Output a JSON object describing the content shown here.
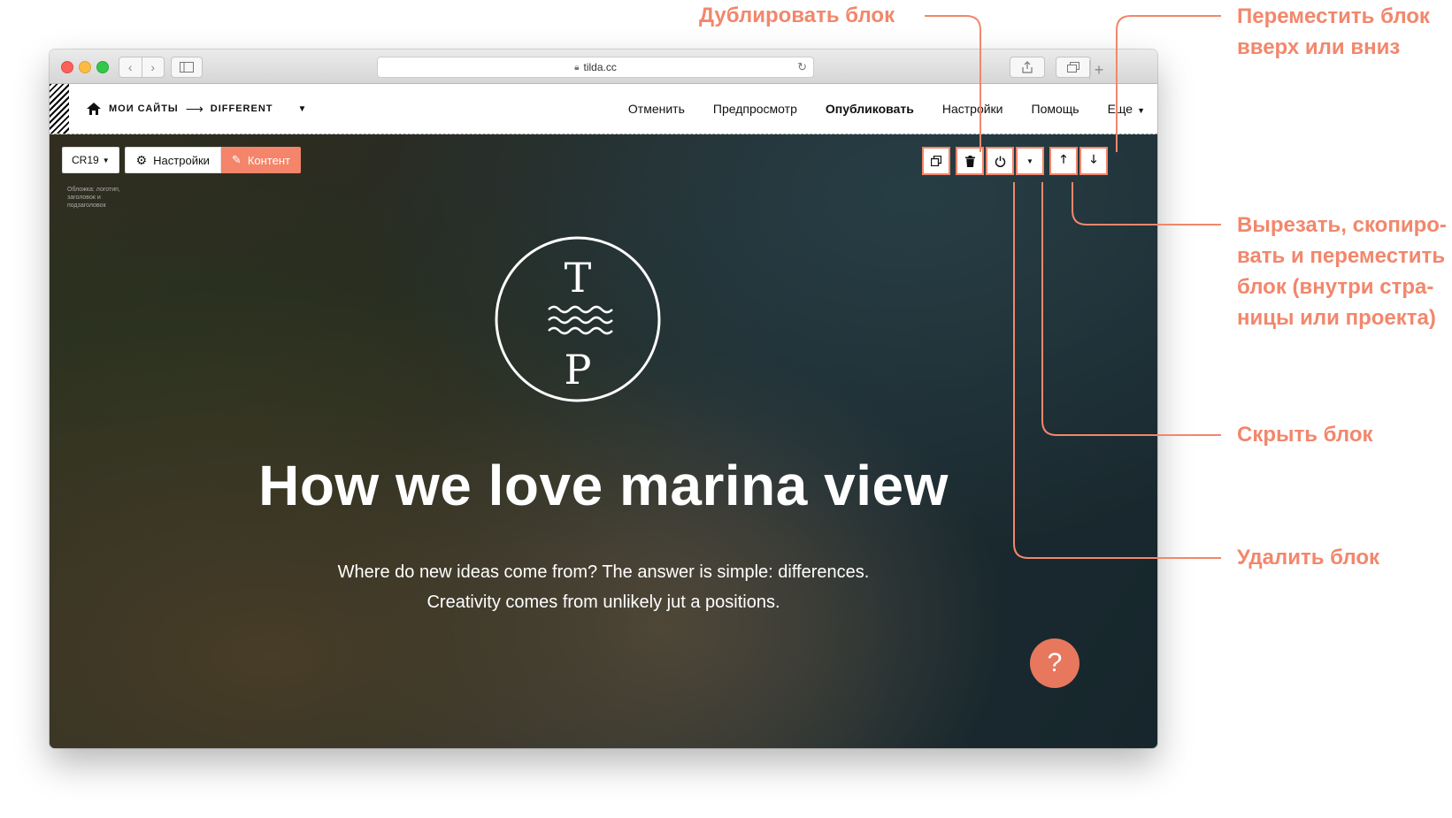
{
  "browser": {
    "url": "tilda.cc",
    "nav_back": "‹",
    "nav_forward": "›"
  },
  "topbar": {
    "breadcrumb_sites": "МОИ САЙТЫ",
    "breadcrumb_arrow": "⟶",
    "breadcrumb_project": "DIFFERENT",
    "menu": [
      "Отменить",
      "Предпросмотр",
      "Опубликовать",
      "Настройки",
      "Помощь",
      "Еще"
    ]
  },
  "block": {
    "code_label": "CR19",
    "settings_label": "Настройки",
    "content_label": "Контент",
    "description": "Обложка: логотип, заголовок и подзаголовок"
  },
  "hero": {
    "logo_top": "T",
    "logo_bottom": "P",
    "title": "How we love marina view",
    "subtitle_line1": "Where do new ideas come from? The answer is simple: differences.",
    "subtitle_line2": "Creativity comes from unlikely jut a positions.",
    "help_label": "?"
  },
  "callouts": {
    "duplicate": "Дублировать блок",
    "move_line1": "Переместить блок",
    "move_line2": "вверх или вниз",
    "cut_line1": "Вырезать, скопиро-",
    "cut_line2": "вать и переместить",
    "cut_line3": "блок (внутри стра-",
    "cut_line4": "ницы или проекта)",
    "hide": "Скрыть блок",
    "delete": "Удалить блок"
  },
  "colors": {
    "accent": "#f4846a",
    "callout_text": "#f2876c",
    "help_button": "#e7785d"
  }
}
